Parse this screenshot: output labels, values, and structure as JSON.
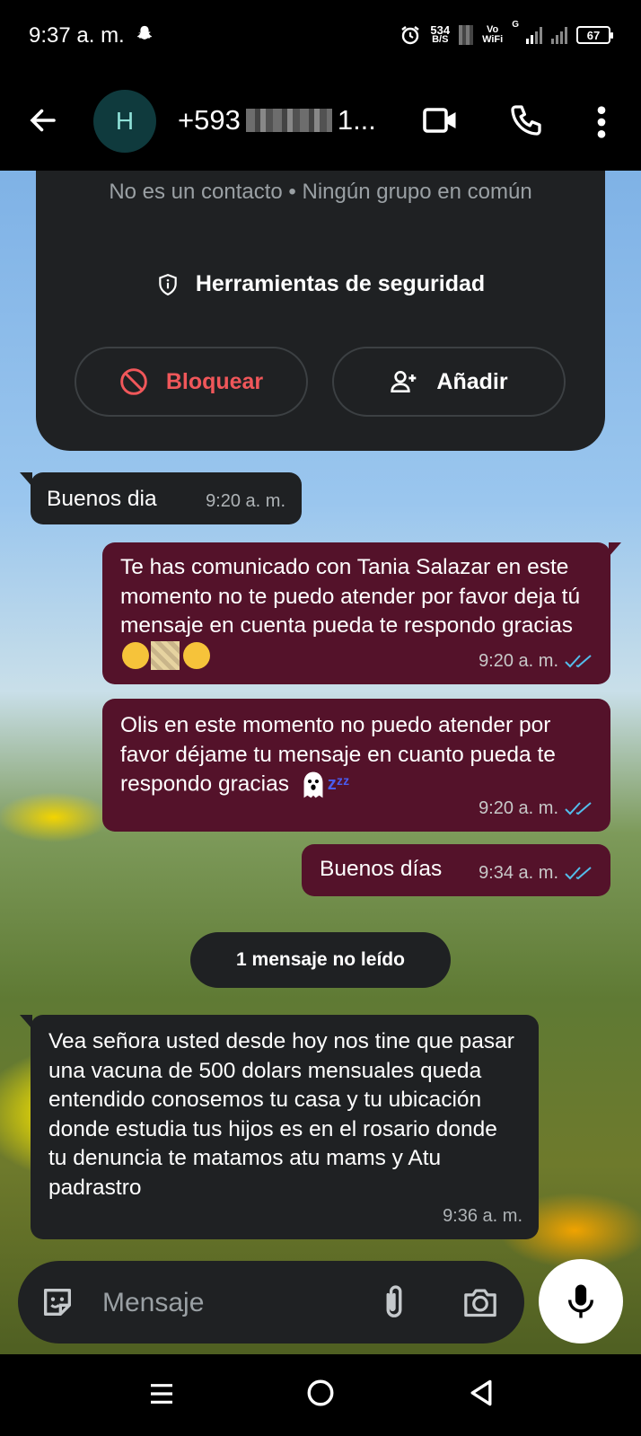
{
  "status_bar": {
    "time": "9:37 a. m.",
    "net_speed_value": "534",
    "net_speed_unit": "B/S",
    "vowifi_top": "Vo",
    "vowifi_bottom": "WiFi",
    "signal_label": "G",
    "battery": "67"
  },
  "header": {
    "avatar_letter": "H",
    "contact_prefix": "+593",
    "contact_suffix": "1..."
  },
  "security_card": {
    "subtitle": "No es un contacto • Ningún grupo en común",
    "tools_label": "Herramientas de seguridad",
    "block_label": "Bloquear",
    "add_label": "Añadir"
  },
  "messages": [
    {
      "direction": "in",
      "text": "Buenos dia",
      "time": "9:20 a. m."
    },
    {
      "direction": "out",
      "text": "Te has comunicado con Tania Salazar en este momento no te puedo atender por favor deja tú mensaje en cuenta pueda te respondo gracias",
      "time": "9:20 a. m."
    },
    {
      "direction": "out",
      "text": "Olis en este momento no puedo atender por favor déjame tu mensaje en cuanto pueda te respondo gracias",
      "zzz": "zᶻᶻ",
      "time": "9:20 a. m."
    },
    {
      "direction": "out",
      "text": "Buenos días",
      "time": "9:34 a. m."
    },
    {
      "direction": "in",
      "text": "Vea señora usted desde hoy nos tine que pasar una vacuna de 500 dolars mensuales queda entendido conosemos tu casa y tu ubicación donde estudia tus hijos es en el rosario donde tu denuncia te matamos atu mams y Atu padrastro",
      "time": "9:36 a. m."
    }
  ],
  "unread_label": "1 mensaje no leído",
  "composer": {
    "placeholder": "Mensaje"
  },
  "colors": {
    "incoming_bubble": "#1f2123",
    "outgoing_bubble": "#54122a",
    "block_red": "#f0575a",
    "read_ticks": "#53bdeb"
  }
}
